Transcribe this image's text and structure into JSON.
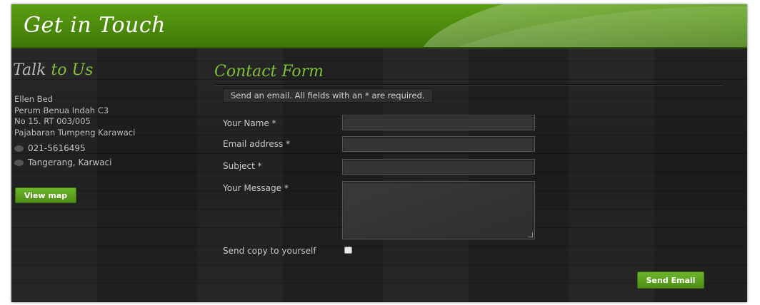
{
  "header": {
    "title": "Get in Touch"
  },
  "talk": {
    "title_part1": "Talk",
    "title_part2": "to Us",
    "address": [
      "Ellen Bed",
      "Perum Benua Indah C3",
      "No 15. RT 003/005",
      "Pajabaran Tumpeng Karawaci"
    ],
    "phone": "021-5616495",
    "location": "Tangerang, Karwaci",
    "view_map_label": "View map"
  },
  "contact": {
    "title": "Contact Form",
    "notice": "Send an email. All fields with an * are required.",
    "fields": {
      "name_label": "Your Name *",
      "email_label": "Email address *",
      "subject_label": "Subject *",
      "message_label": "Your Message *",
      "copy_label": "Send copy to yourself"
    },
    "send_label": "Send Email"
  },
  "colors": {
    "accent": "#5a9e12",
    "script_green": "#7fbf3a",
    "panel_bg": "#222222"
  }
}
